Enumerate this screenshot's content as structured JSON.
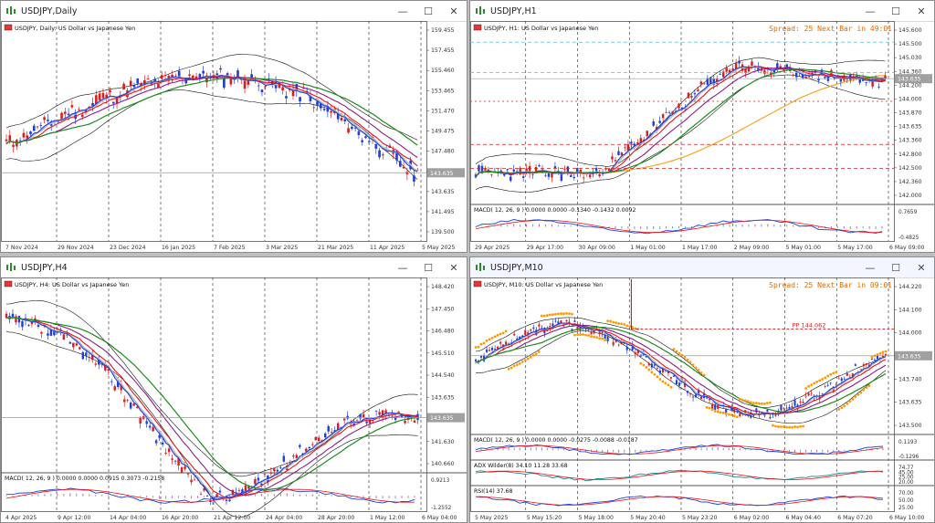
{
  "colors": {
    "grid": "#555555",
    "axis_text": "#333333",
    "bull": "#1f3fd8",
    "bear": "#d81f1f",
    "ma_red": "#e8161b",
    "ma_purple": "#8b1e8b",
    "ma_green": "#1e8b1e",
    "ma_orange": "#f5a623",
    "bb": "#111111",
    "price_line": "#9a9a9a",
    "spread": "#e06a00",
    "sar": "#ff9900",
    "pp": "#d81f1f"
  },
  "windows": [
    {
      "id": "daily",
      "title": "USDJPY,Daily",
      "label": "USDJPY, Daily:  US Dollar vs Japanese Yen",
      "price_badge": "143.635",
      "price_axis": [
        "159.455",
        "157.455",
        "155.460",
        "153.465",
        "151.470",
        "149.475",
        "147.480",
        "145.485",
        "143.635",
        "141.495",
        "139.500"
      ],
      "time_axis": [
        "7 Nov 2024",
        "29 Nov 2024",
        "23 Dec 2024",
        "16 Jan 2025",
        "7 Feb 2025",
        "3 Mar 2025",
        "21 Mar 2025",
        "11 Apr 2025",
        "5 May 2025"
      ],
      "spread": "",
      "indicators": []
    },
    {
      "id": "h1",
      "title": "USDJPY,H1",
      "label": "USDJPY, H1:  US Dollar vs Japanese Yen",
      "price_badge": "143.635",
      "price_axis": [
        "145.600",
        "145.500",
        "145.030",
        "144.360",
        "144.200",
        "144.000",
        "143.870",
        "143.635",
        "143.360",
        "142.800",
        "142.500",
        "142.360",
        "142.000"
      ],
      "time_axis": [
        "29 Apr 2025",
        "29 Apr 17:00",
        "30 Apr 09:00",
        "1 May 01:00",
        "1 May 17:00",
        "2 May 09:00",
        "5 May 01:00",
        "5 May 17:00",
        "6 May 09:00"
      ],
      "spread": "Spread: 25  Next Bar in 49:01",
      "indicators": [
        {
          "label": "MACD( 12, 26, 9 ) 0.0000 0.0000 -0.1340 -0.1432 0.0092",
          "axis": [
            "0.7659",
            "-0.4825"
          ]
        }
      ]
    },
    {
      "id": "h4",
      "title": "USDJPY,H4",
      "label": "USDJPY, H4:  US Dollar vs Japanese Yen",
      "price_badge": "143.635",
      "price_axis": [
        "148.420",
        "147.450",
        "146.480",
        "145.510",
        "144.540",
        "143.635",
        "142.600",
        "141.630",
        "140.660"
      ],
      "time_axis": [
        "4 Apr 2025",
        "9 Apr 12:00",
        "14 Apr 04:00",
        "16 Apr 20:00",
        "21 Apr 12:00",
        "24 Apr 04:00",
        "28 Apr 20:00",
        "1 May 12:00",
        "6 May 04:00"
      ],
      "spread": "",
      "indicators": [
        {
          "label": "MACD( 12, 26, 9 ) 0.0000 0.0000 0.0915 0.3073 -0.2158",
          "axis": [
            "0.9213",
            "-1.2552"
          ]
        }
      ]
    },
    {
      "id": "m10",
      "title": "USDJPY,M10",
      "label": "USDJPY, M10:  US Dollar vs Japanese Yen",
      "price_badge": "143.635",
      "price_axis": [
        "144.220",
        "144.100",
        "144.000",
        "143.860",
        "143.740",
        "143.635",
        "143.500"
      ],
      "time_axis": [
        "5 May 2025",
        "5 May 15:20",
        "5 May 18:00",
        "5 May 20:40",
        "5 May 23:20",
        "6 May 02:00",
        "6 May 04:40",
        "6 May 07:20",
        "6 May 10:00"
      ],
      "spread": "Spread: 25  Next Bar in 09:01",
      "pp_label": "PP 144.062",
      "indicators": [
        {
          "label": "MACD( 12, 26, 9 ) 0.0000 0.0000 -0.0275 -0.0088 -0.0187",
          "axis": [
            "0.1193",
            "-0.1296"
          ]
        },
        {
          "label": "ADX Wilder(8) 34.10 11.28 33.68",
          "axis": [
            "74.77",
            "45.00",
            "25.00",
            "20.00"
          ]
        },
        {
          "label": "RSI(14) 37.68",
          "axis": [
            "70.00",
            "50.00",
            "25.00"
          ]
        }
      ]
    }
  ]
}
